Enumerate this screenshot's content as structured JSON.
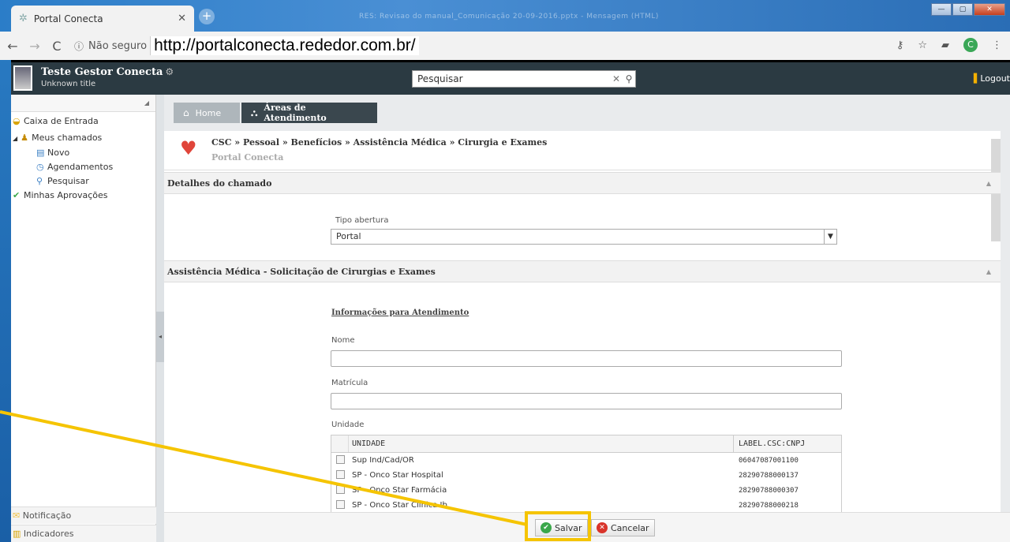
{
  "browser": {
    "tab_title": "Portal Conecta",
    "window_title_blurred": "RES: Revisao do manual_Comunicação 20-09-2016.pptx - Mensagem (HTML)",
    "security_label": "Não seguro",
    "url": "http://portalconecta.rededor.com.br/",
    "profile_initial": "C"
  },
  "header": {
    "user_name": "Teste Gestor Conecta",
    "user_title": "Unknown title",
    "search_value": "Pesquisar",
    "logout_label": "Logout"
  },
  "sidebar": {
    "inbox": "Caixa de Entrada",
    "my_calls": "Meus chamados",
    "new": "Novo",
    "schedules": "Agendamentos",
    "search": "Pesquisar",
    "approvals": "Minhas Aprovações",
    "notifications": "Notificação",
    "indicators": "Indicadores"
  },
  "tabs": {
    "home": "Home",
    "areas": "Áreas de Atendimento"
  },
  "breadcrumb": {
    "path": "CSC » Pessoal » Benefícios » Assistência Médica » Cirurgia e Exames",
    "sub": "Portal Conecta"
  },
  "sections": {
    "details": "Detalhes do chamado",
    "request": "Assistência Médica - Solicitação de Cirurgias e Exames"
  },
  "form": {
    "tipo_label": "Tipo abertura",
    "tipo_value": "Portal",
    "info_title": "Informações para Atendimento",
    "nome_label": "Nome",
    "matricula_label": "Matrícula",
    "unidade_label": "Unidade"
  },
  "grid": {
    "headers": [
      "UNIDADE",
      "LABEL.CSC:CNPJ"
    ],
    "rows": [
      {
        "unidade": "Sup Ind/Cad/OR",
        "cnpj": "06047087001100"
      },
      {
        "unidade": "SP - Onco Star Hospital",
        "cnpj": "28290788000137"
      },
      {
        "unidade": "SP - Onco Star Farmácia",
        "cnpj": "28290788000307"
      },
      {
        "unidade": "SP - Onco Star Clínica Ib",
        "cnpj": "28290788000218"
      }
    ]
  },
  "footer": {
    "save": "Salvar",
    "cancel": "Cancelar"
  },
  "colors": {
    "highlight": "#f5c400",
    "header_bg": "#2b3a42",
    "accent_blue": "#1e6fb8"
  }
}
